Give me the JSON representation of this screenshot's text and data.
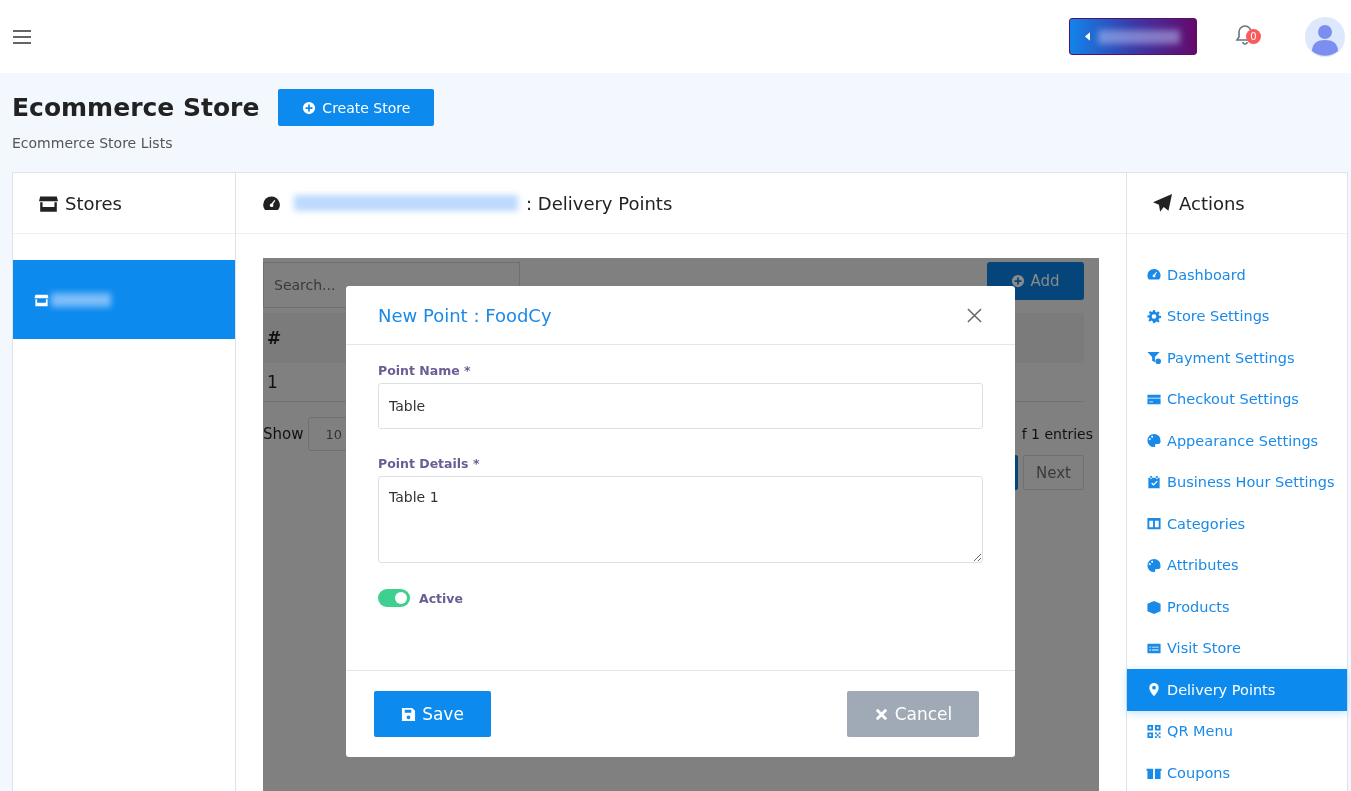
{
  "header": {
    "notification_count": "0"
  },
  "page": {
    "title": "Ecommerce Store",
    "create_button": "Create Store",
    "subtitle": "Ecommerce Store Lists"
  },
  "stores": {
    "heading": "Stores",
    "items": [
      {
        "selected": true
      }
    ]
  },
  "main": {
    "heading_suffix": ": Delivery Points",
    "search_placeholder": "Search...",
    "add_button": "Add",
    "table": {
      "columns": [
        "#"
      ],
      "rows": [
        [
          "1"
        ]
      ]
    },
    "show_label": "Show",
    "page_size": "10",
    "entries_info": "f 1 entries",
    "pagination": [
      {
        "selected": true
      },
      {
        "label": "Next",
        "selected": false
      }
    ]
  },
  "modal": {
    "title": "New Point : FoodCy",
    "fields": [
      {
        "label": "Point Name *",
        "kind": "input",
        "value": "Table"
      },
      {
        "label": "Point Details *",
        "kind": "textarea",
        "value": "Table 1"
      }
    ],
    "toggle": {
      "label": "Active",
      "on": true
    },
    "save": "Save",
    "cancel": "Cancel"
  },
  "actions": {
    "heading": "Actions",
    "items": [
      {
        "label": "Dashboard",
        "selected": false
      },
      {
        "label": "Store Settings",
        "selected": false
      },
      {
        "label": "Payment Settings",
        "selected": false
      },
      {
        "label": "Checkout Settings",
        "selected": false
      },
      {
        "label": "Appearance Settings",
        "selected": false
      },
      {
        "label": "Business Hour Settings",
        "selected": false
      },
      {
        "label": "Categories",
        "selected": false
      },
      {
        "label": "Attributes",
        "selected": false
      },
      {
        "label": "Products",
        "selected": false
      },
      {
        "label": "Visit Store",
        "selected": false
      },
      {
        "label": "Delivery Points",
        "selected": true
      },
      {
        "label": "QR Menu",
        "selected": false
      },
      {
        "label": "Coupons",
        "selected": false
      }
    ]
  }
}
